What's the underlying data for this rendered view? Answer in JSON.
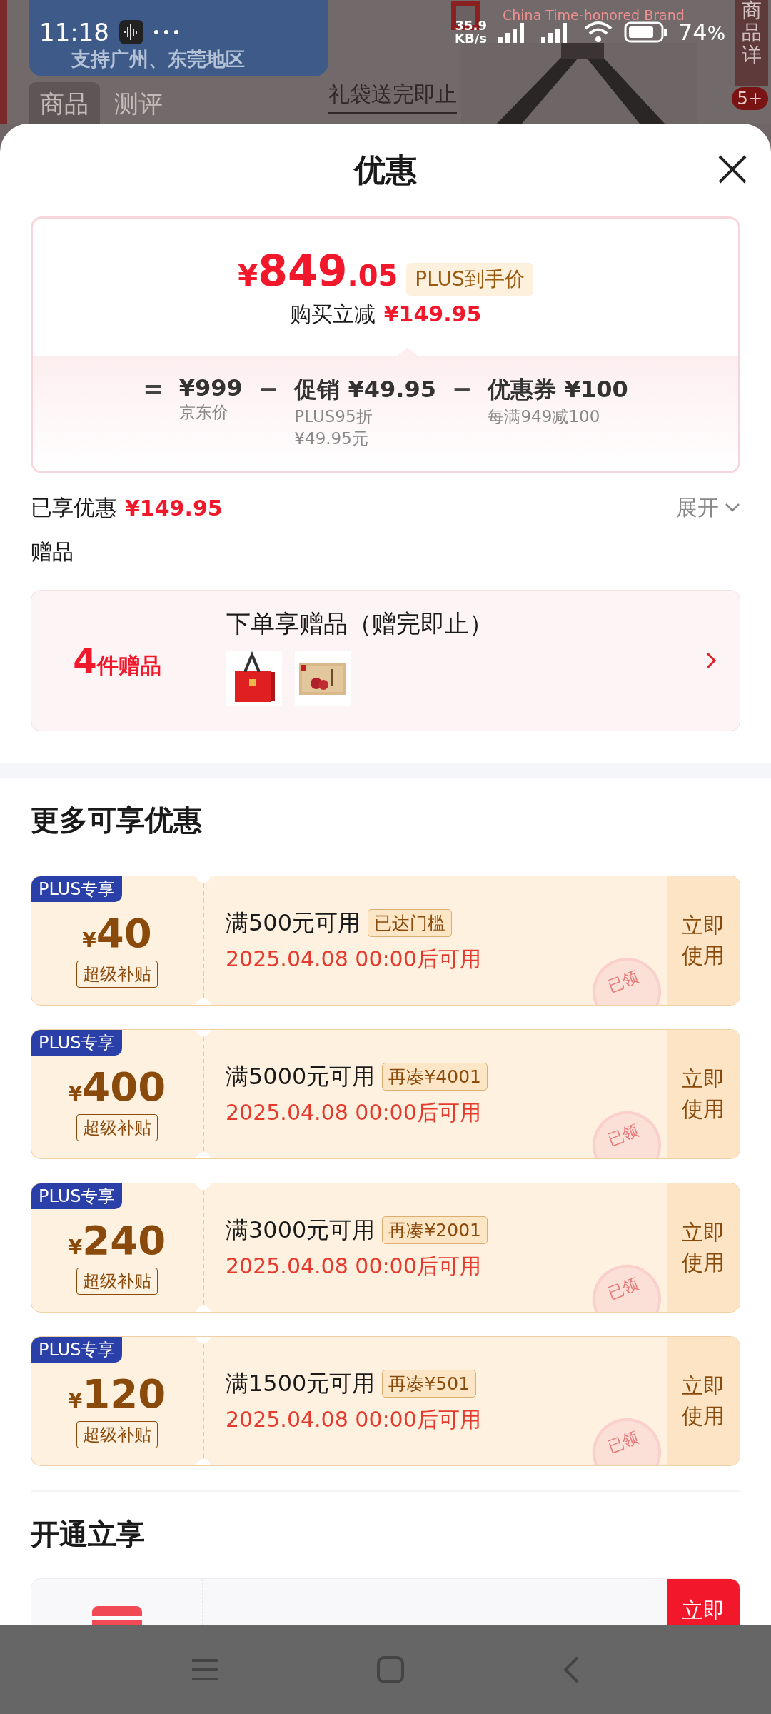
{
  "status_bar": {
    "time": "11:18",
    "net_speed": "35.9",
    "net_unit": "KB/s",
    "battery": "74",
    "battery_unit": "%"
  },
  "background": {
    "banner_subtitle": "支持广州、东莞地区",
    "brand_tagline": "China Time-honored Brand",
    "promo_label": "礼袋送完即止",
    "side_tab": "商品详",
    "side_badge": "5+",
    "tabs": [
      {
        "label": "商品",
        "selected": true
      },
      {
        "label": "测评",
        "selected": false
      }
    ]
  },
  "sheet": {
    "title": "优惠"
  },
  "price_card": {
    "currency": "¥",
    "integer": "849",
    "decimal": ".05",
    "tag": "PLUS到手价",
    "saving_label": "购买立减",
    "saving_amount": "¥149.95",
    "breakdown": [
      {
        "operator": "=",
        "label": "¥999",
        "notes": [
          "京东价"
        ]
      },
      {
        "operator": "−",
        "label": "促销 ¥49.95",
        "notes": [
          "PLUS95折",
          "¥49.95元"
        ]
      },
      {
        "operator": "−",
        "label": "优惠券 ¥100",
        "notes": [
          "每满949减100"
        ]
      }
    ]
  },
  "enjoyed": {
    "label": "已享优惠",
    "amount": "¥149.95",
    "toggle": "展开",
    "expanded": false
  },
  "gifts": {
    "section_title": "赠品",
    "count": "4",
    "count_unit": "件赠品",
    "title": "下单享赠品（赠完即止）"
  },
  "coupons": {
    "section_title": "更多可享优惠",
    "items": [
      {
        "badge": "PLUS专享",
        "currency": "¥",
        "amount": "40",
        "tag": "超级补贴",
        "condition": "满500元可用",
        "status": "已达门槛",
        "date": "2025.04.08 00:00后可用",
        "action": "立即使用",
        "stamp": "已领"
      },
      {
        "badge": "PLUS专享",
        "currency": "¥",
        "amount": "400",
        "tag": "超级补贴",
        "condition": "满5000元可用",
        "status": "再凑¥4001",
        "date": "2025.04.08 00:00后可用",
        "action": "立即使用",
        "stamp": "已领"
      },
      {
        "badge": "PLUS专享",
        "currency": "¥",
        "amount": "240",
        "tag": "超级补贴",
        "condition": "满3000元可用",
        "status": "再凑¥2001",
        "date": "2025.04.08 00:00后可用",
        "action": "立即使用",
        "stamp": "已领"
      },
      {
        "badge": "PLUS专享",
        "currency": "¥",
        "amount": "120",
        "tag": "超级补贴",
        "condition": "满1500元可用",
        "status": "再凑¥501",
        "date": "2025.04.08 00:00后可用",
        "action": "立即使用",
        "stamp": "已领"
      }
    ]
  },
  "open_section": {
    "title": "开通立享",
    "action": "立即"
  }
}
